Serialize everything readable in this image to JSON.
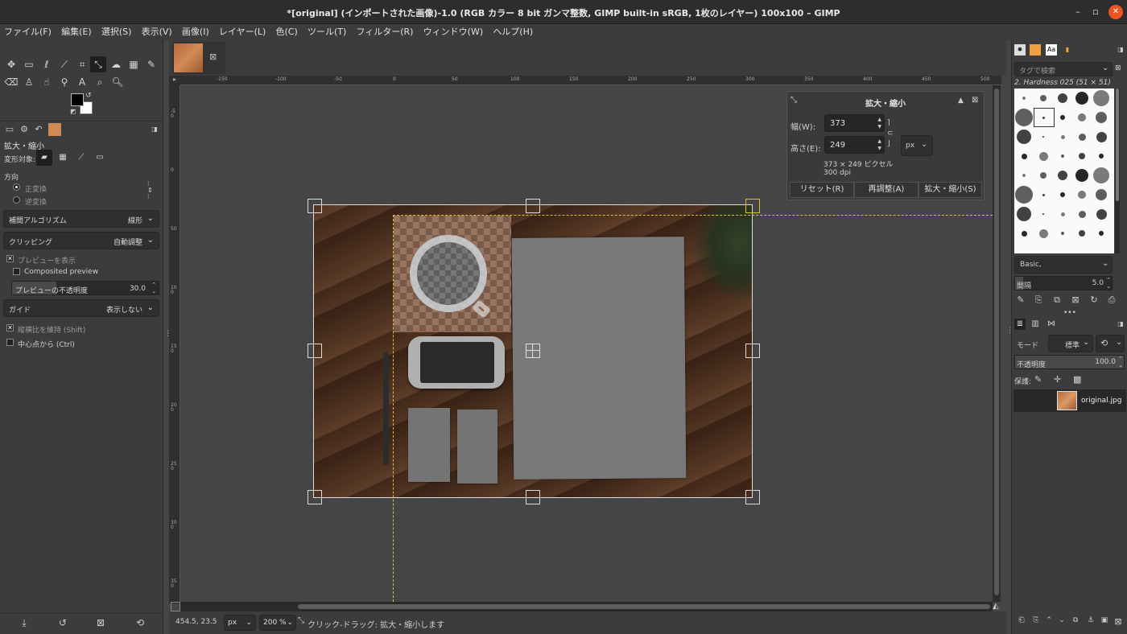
{
  "window": {
    "title": "*[original] (インポートされた画像)-1.0 (RGB カラー 8 bit ガンマ整数, GIMP built-in sRGB, 1枚のレイヤー) 100x100 – GIMP",
    "minimize": "–",
    "maximize": "▫",
    "close": "✕"
  },
  "menu": [
    "ファイル(F)",
    "編集(E)",
    "選択(S)",
    "表示(V)",
    "画像(I)",
    "レイヤー(L)",
    "色(C)",
    "ツール(T)",
    "フィルター(R)",
    "ウィンドウ(W)",
    "ヘルプ(H)"
  ],
  "tool_options": {
    "title": "拡大・縮小",
    "transform_label": "変形対象:",
    "direction_label": "方向",
    "direction_normal": "正変換",
    "direction_reverse": "逆変換",
    "interpolation_label": "補間アルゴリズム",
    "interpolation_value": "線形",
    "clipping_label": "クリッピング",
    "clipping_value": "自動調整",
    "show_preview": "プレビューを表示",
    "composited_preview": "Composited preview",
    "preview_opacity_label": "プレビューの不透明度",
    "preview_opacity_value": "30.0",
    "preview_opacity_fraction": 0.3,
    "guides_label": "ガイド",
    "guides_value": "表示しない",
    "keep_aspect": "縦横比を維持 (Shift)",
    "from_center": "中心点から (Ctrl)"
  },
  "ruler": {
    "h_ticks": [
      "-150",
      "-100",
      "-50",
      "0",
      "50",
      "100",
      "150",
      "200",
      "250",
      "300",
      "350",
      "400",
      "450",
      "500"
    ],
    "v_ticks": [
      "-50",
      "0",
      "50",
      "100",
      "150",
      "200",
      "250",
      "300",
      "350"
    ]
  },
  "scale_dialog": {
    "title": "拡大・縮小",
    "width_label": "幅(W):",
    "width_value": "373",
    "height_label": "高さ(E):",
    "height_value": "249",
    "unit": "px",
    "size_info": "373 × 249 ピクセル",
    "dpi_info": "300 dpi",
    "reset_button": "リセット(R)",
    "readjust_button": "再調整(A)",
    "scale_button": "拡大・縮小(S)"
  },
  "brushes": {
    "tag_placeholder": "タグで検索",
    "current_brush": "2. Hardness 025 (51 × 51)",
    "preset": "Basic,",
    "spacing_label": "間隔",
    "spacing_value": "5.0"
  },
  "layers": {
    "mode_label": "モード",
    "mode_value": "標準",
    "opacity_label": "不透明度",
    "opacity_value": "100.0",
    "lock_label": "保護:",
    "layer_name": "original.jpg"
  },
  "status": {
    "coords": "454.5, 23.5",
    "unit": "px",
    "zoom": "200 %",
    "message": "クリック-ドラッグ: 拡大・縮小します"
  }
}
